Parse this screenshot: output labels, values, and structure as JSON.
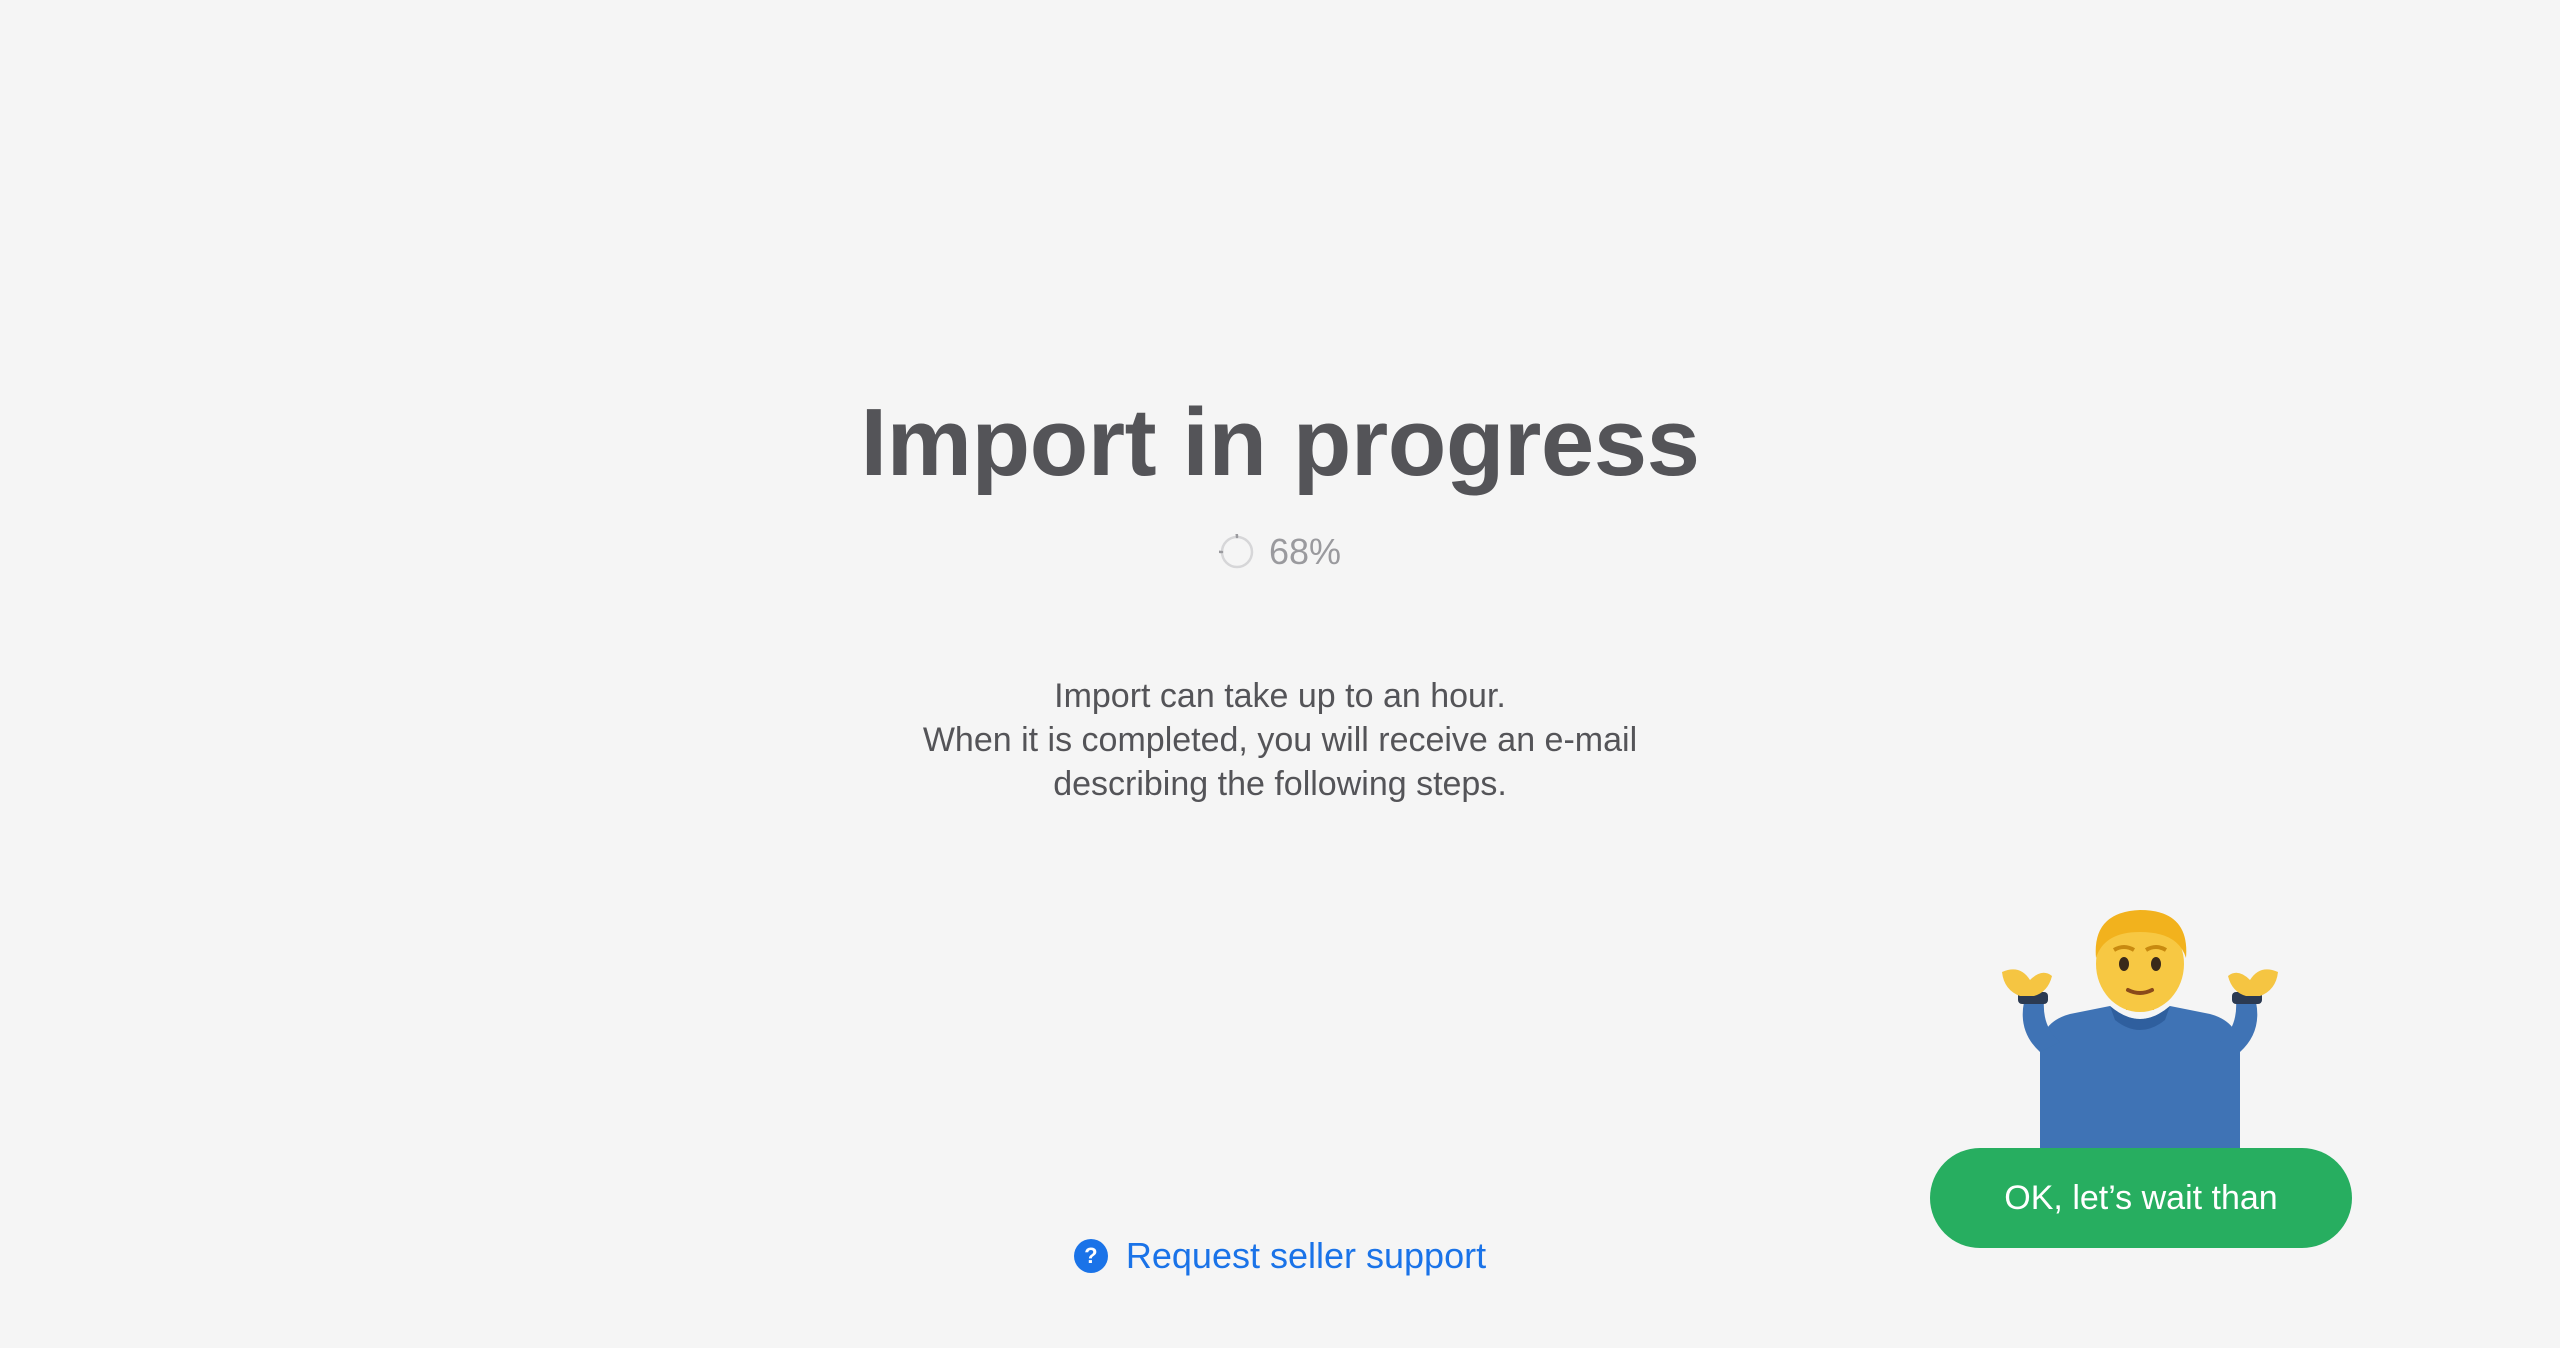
{
  "main": {
    "title": "Import in progress",
    "progress": {
      "percent": 68,
      "label": "68%"
    },
    "description": [
      "Import can take up to an hour.",
      "When it is completed, you will receive an e-mail",
      "describing the following steps."
    ]
  },
  "support": {
    "icon": "question-icon",
    "icon_glyph": "?",
    "label": "Request seller support"
  },
  "emoji": {
    "name": "person-shrugging-icon"
  },
  "ok_button": {
    "label": "OK, let’s wait than"
  },
  "colors": {
    "background": "#f5f5f5",
    "title": "#545458",
    "muted": "#9a9a9e",
    "link": "#1a73e8",
    "button": "#27ae60"
  }
}
